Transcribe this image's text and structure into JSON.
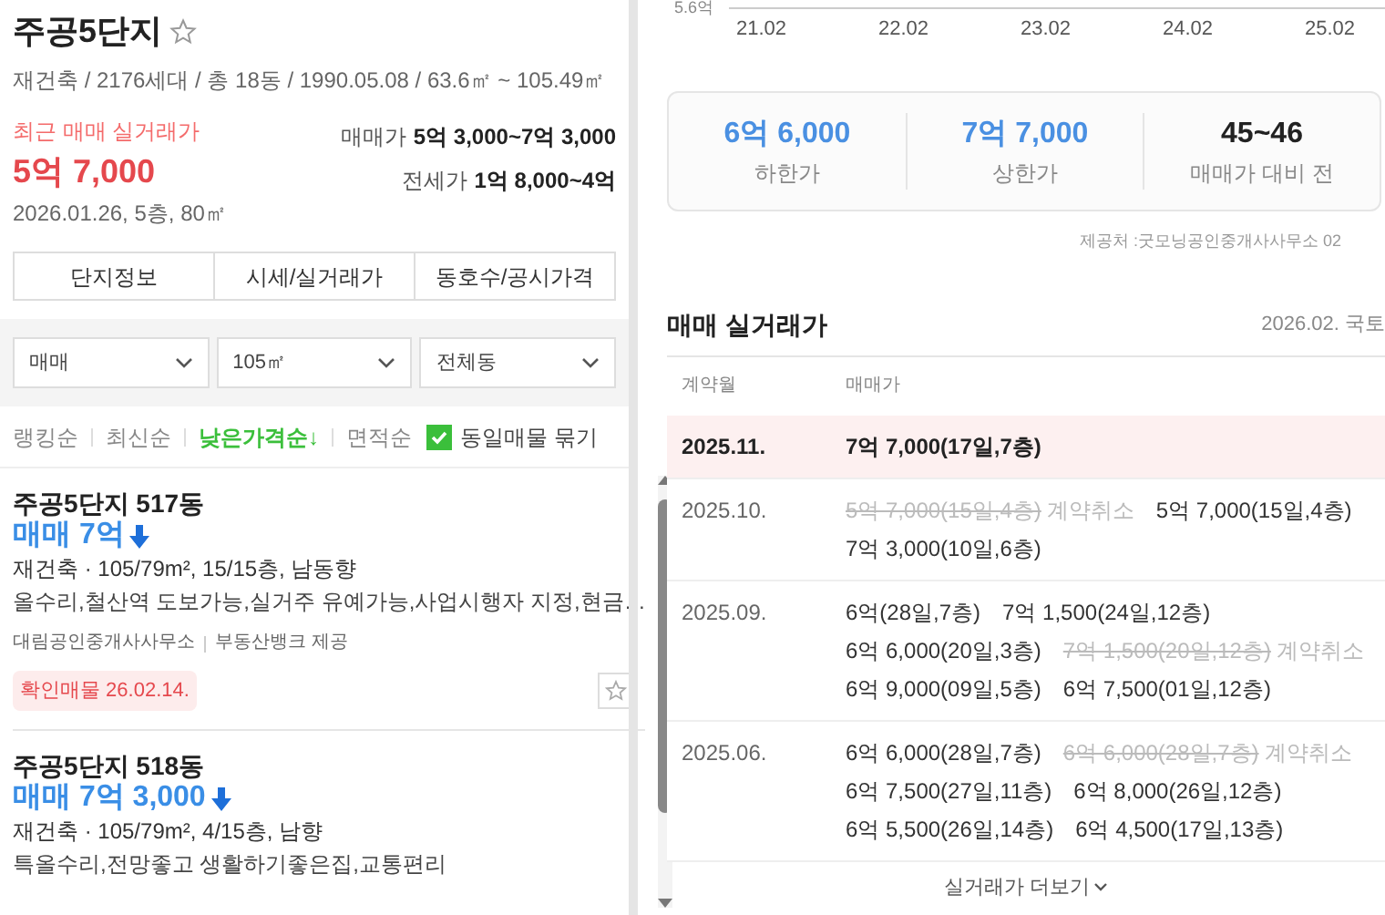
{
  "complex": {
    "name": "주공5단지",
    "favorite": false,
    "summary": "재건축 / 2176세대 / 총 18동 / 1990.05.08 / 63.6㎡ ~ 105.49㎡",
    "recent_label": "최근 매매 실거래가",
    "recent_price": "5억 7,000",
    "recent_detail": "2026.01.26, 5층, 80㎡",
    "prices": [
      {
        "label": "매매가",
        "value": "5억 3,000~7억 3,000"
      },
      {
        "label": "전세가",
        "value": "1억 8,000~4억"
      }
    ]
  },
  "tabs": [
    {
      "label": "단지정보",
      "selected": false
    },
    {
      "label": "시세/실거래가",
      "selected": false
    },
    {
      "label": "동호수/공시가격",
      "selected": false
    }
  ],
  "filters": [
    {
      "value": "매매"
    },
    {
      "value": "105㎡"
    },
    {
      "value": "전체동"
    }
  ],
  "sorts": [
    {
      "label": "랭킹순",
      "selected": false
    },
    {
      "label": "최신순",
      "selected": false
    },
    {
      "label": "낮은가격순↓",
      "selected": true
    },
    {
      "label": "면적순",
      "selected": false
    }
  ],
  "group_same": {
    "label": "동일매물 묶기",
    "checked": true
  },
  "listings": [
    {
      "title": "주공5단지 517동",
      "price": "매매 7억",
      "details": "재건축 · 105/79m², 15/15층, 남동향",
      "description": "올수리,철산역 도보가능,실거주 유예가능,사업시행자 지정,현금…",
      "agent": "대림공인중개사사무소",
      "source": "부동산뱅크 제공",
      "badge": "확인매물 26.02.14.",
      "favorite": false
    },
    {
      "title": "주공5단지 518동",
      "price": "매매 7억 3,000",
      "details": "재건축 · 105/79m², 4/15층, 남향",
      "description": "특올수리,전망좋고 생활하기좋은집,교통편리"
    }
  ],
  "chart": {
    "y_label": "5.6억",
    "x_labels": [
      "21.02",
      "22.02",
      "23.02",
      "24.02",
      "25.02"
    ]
  },
  "estimate": [
    {
      "value": "6억 6,000",
      "label": "하한가",
      "kind": "price"
    },
    {
      "value": "7억 7,000",
      "label": "상한가",
      "kind": "price"
    },
    {
      "value": "45~46",
      "label": "매매가 대비 전",
      "kind": "ratio"
    }
  ],
  "provider": "제공처 :굿모닝공인중개사사무소 02",
  "trades": {
    "title": "매매 실거래가",
    "date": "2026.02. 국토",
    "columns": [
      "계약월",
      "매매가"
    ],
    "months": [
      {
        "month": "2025.11.",
        "highlighted": true,
        "lines": [
          [
            {
              "price": "7억 7,000(17일,7층)",
              "cancelled": false
            }
          ]
        ]
      },
      {
        "month": "2025.10.",
        "highlighted": false,
        "lines": [
          [
            {
              "price": "5억 7,000(15일,4층)",
              "cancelled": true,
              "note": "계약취소"
            },
            {
              "price": "5억 7,000(15일,4층)",
              "cancelled": false
            }
          ],
          [
            {
              "price": "7억 3,000(10일,6층)",
              "cancelled": false
            }
          ]
        ]
      },
      {
        "month": "2025.09.",
        "highlighted": false,
        "lines": [
          [
            {
              "price": "6억(28일,7층)",
              "cancelled": false
            },
            {
              "price": "7억 1,500(24일,12층)",
              "cancelled": false
            }
          ],
          [
            {
              "price": "6억 6,000(20일,3층)",
              "cancelled": false
            },
            {
              "price": "7억 1,500(20일,12층)",
              "cancelled": true,
              "note": "계약취소"
            }
          ],
          [
            {
              "price": "6억 9,000(09일,5층)",
              "cancelled": false
            },
            {
              "price": "6억 7,500(01일,12층)",
              "cancelled": false
            }
          ]
        ]
      },
      {
        "month": "2025.06.",
        "highlighted": false,
        "lines": [
          [
            {
              "price": "6억 6,000(28일,7층)",
              "cancelled": false
            },
            {
              "price": "6억 6,000(28일,7층)",
              "cancelled": true,
              "note": "계약취소"
            }
          ],
          [
            {
              "price": "6억 7,500(27일,11층)",
              "cancelled": false
            },
            {
              "price": "6억 8,000(26일,12층)",
              "cancelled": false
            }
          ],
          [
            {
              "price": "6억 5,500(26일,14층)",
              "cancelled": false
            },
            {
              "price": "6억 4,500(17일,13층)",
              "cancelled": false
            }
          ]
        ]
      }
    ],
    "more": "실거래가 더보기"
  }
}
